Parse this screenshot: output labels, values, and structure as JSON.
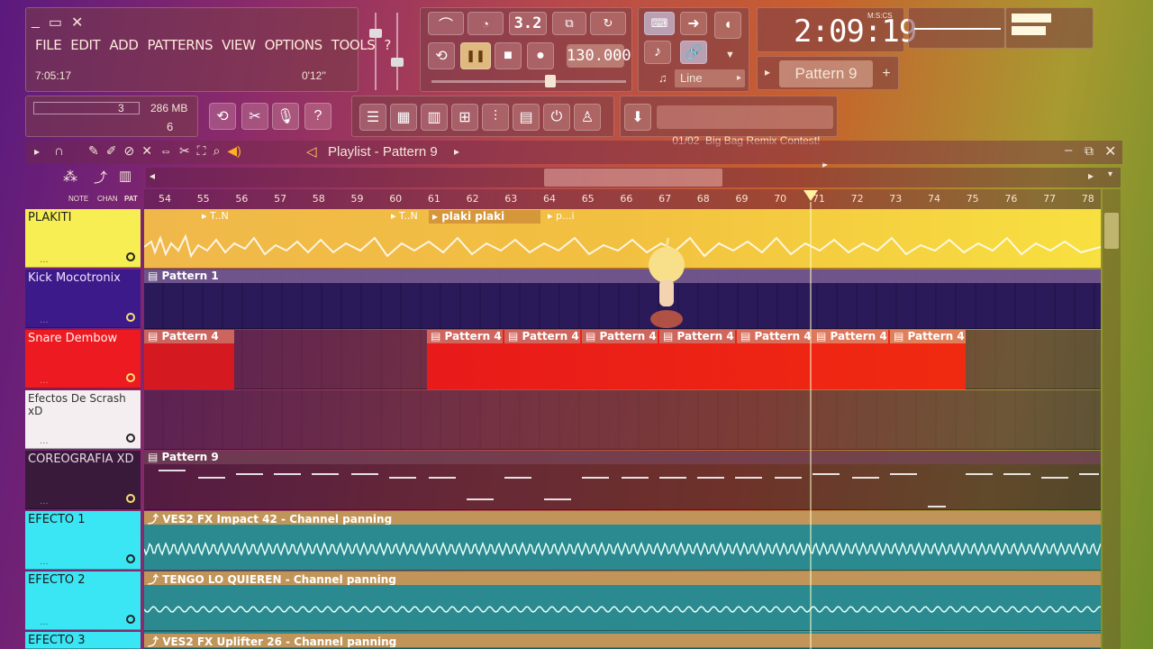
{
  "window": {
    "menu": [
      "FILE",
      "EDIT",
      "ADD",
      "PATTERNS",
      "VIEW",
      "OPTIONS",
      "TOOLS",
      "?"
    ],
    "time_left": "7:05:17",
    "time_right": "0'12''"
  },
  "transport": {
    "tempo": "130.000",
    "clock": "2:09:19",
    "clock_unit": "M:S:CS",
    "time_sig": "3.2",
    "snap": "Line",
    "pattern": "Pattern 9"
  },
  "resources": {
    "cpu": "3",
    "ram": "286 MB",
    "poly": "6"
  },
  "news": {
    "text": "01/02  Big Bag Remix Contest!"
  },
  "playlist": {
    "title": "Playlist - Pattern 9",
    "mode_labels": [
      "NOTE",
      "CHAN",
      "PAT"
    ],
    "ruler": [
      "54",
      "55",
      "56",
      "57",
      "58",
      "59",
      "60",
      "61",
      "62",
      "63",
      "64",
      "65",
      "66",
      "67",
      "68",
      "69",
      "70",
      "71",
      "72",
      "73",
      "74",
      "75",
      "76",
      "77",
      "78"
    ]
  },
  "tracks": [
    {
      "name": "PLAKITI",
      "color": "#f6ee52",
      "text_color": "#222222"
    },
    {
      "name": "Kick Mocotronix",
      "color": "#3d1a8a",
      "text_color": "#f0e4ff"
    },
    {
      "name": "Snare Dembow",
      "color": "#ee1a22",
      "text_color": "#fff4f0"
    },
    {
      "name": "Efectos De Scrash xD",
      "color": "#f4eef0",
      "text_color": "#333333"
    },
    {
      "name": "COREOGRAFIA XD",
      "color": "#3a1a3a",
      "text_color": "#e8d8e8"
    },
    {
      "name": "EFECTO 1",
      "color": "#3ae6f4",
      "text_color": "#1a1a1a"
    },
    {
      "name": "EFECTO 2",
      "color": "#3ae6f4",
      "text_color": "#1a1a1a"
    },
    {
      "name": "EFECTO 3",
      "color": "#3ae6f4",
      "text_color": "#1a1a1a"
    }
  ],
  "clips": {
    "plakiti_labels": [
      "T..N",
      "T..N",
      "plaki plaki",
      "p...i"
    ],
    "kick": "Pattern 1",
    "snare": [
      "Pattern 4",
      "Pattern 4",
      "Pattern 4",
      "Pattern 4",
      "Pattern 4",
      "Pattern 4",
      "Pattern 4",
      "Pattern 4"
    ],
    "coreografia": "Pattern 9",
    "efecto1": "VES2 FX Impact 42 - Channel panning",
    "efecto2": "TENGO LO QUIEREN - Channel panning",
    "efecto3": "VES2 FX Uplifter 26 - Channel panning"
  }
}
